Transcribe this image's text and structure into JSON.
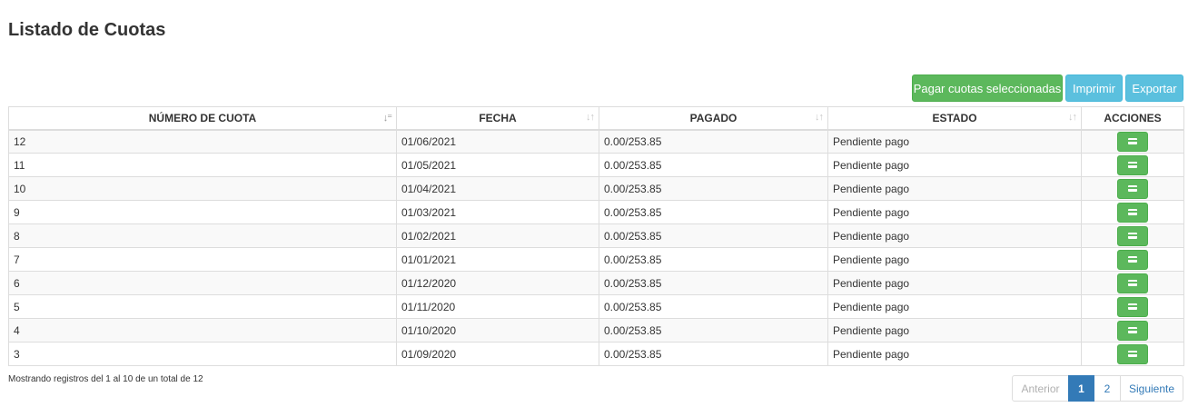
{
  "page": {
    "title": "Listado de Cuotas"
  },
  "toolbar": {
    "pay_selected_label": "Pagar cuotas seleccionadas",
    "print_label": "Imprimir",
    "export_label": "Exportar"
  },
  "table": {
    "columns": [
      {
        "label": "NÚMERO DE CUOTA",
        "sort_icon": "sort-numeric-desc-icon",
        "active": true
      },
      {
        "label": "FECHA",
        "sort_icon": "sort-both-icon",
        "active": false
      },
      {
        "label": "PAGADO",
        "sort_icon": "sort-both-icon",
        "active": false
      },
      {
        "label": "ESTADO",
        "sort_icon": "sort-both-icon",
        "active": false
      },
      {
        "label": "ACCIONES"
      }
    ],
    "rows": [
      {
        "numero": "12",
        "fecha": "01/06/2021",
        "pagado": "0.00/253.85",
        "estado": "Pendiente pago"
      },
      {
        "numero": "11",
        "fecha": "01/05/2021",
        "pagado": "0.00/253.85",
        "estado": "Pendiente pago"
      },
      {
        "numero": "10",
        "fecha": "01/04/2021",
        "pagado": "0.00/253.85",
        "estado": "Pendiente pago"
      },
      {
        "numero": "9",
        "fecha": "01/03/2021",
        "pagado": "0.00/253.85",
        "estado": "Pendiente pago"
      },
      {
        "numero": "8",
        "fecha": "01/02/2021",
        "pagado": "0.00/253.85",
        "estado": "Pendiente pago"
      },
      {
        "numero": "7",
        "fecha": "01/01/2021",
        "pagado": "0.00/253.85",
        "estado": "Pendiente pago"
      },
      {
        "numero": "6",
        "fecha": "01/12/2020",
        "pagado": "0.00/253.85",
        "estado": "Pendiente pago"
      },
      {
        "numero": "5",
        "fecha": "01/11/2020",
        "pagado": "0.00/253.85",
        "estado": "Pendiente pago"
      },
      {
        "numero": "4",
        "fecha": "01/10/2020",
        "pagado": "0.00/253.85",
        "estado": "Pendiente pago"
      },
      {
        "numero": "3",
        "fecha": "01/09/2020",
        "pagado": "0.00/253.85",
        "estado": "Pendiente pago"
      }
    ],
    "action_icon": "credit-card-icon"
  },
  "footer": {
    "info": "Mostrando registros del 1 al 10 de un total de 12",
    "pagination": {
      "previous": "Anterior",
      "pages": [
        "1",
        "2"
      ],
      "current_page": "1",
      "next": "Siguiente"
    }
  },
  "colors": {
    "success": "#5cb85c",
    "info": "#5bc0de",
    "primary": "#337ab7",
    "border": "#dddddd",
    "stripe": "#f9f9f9"
  }
}
